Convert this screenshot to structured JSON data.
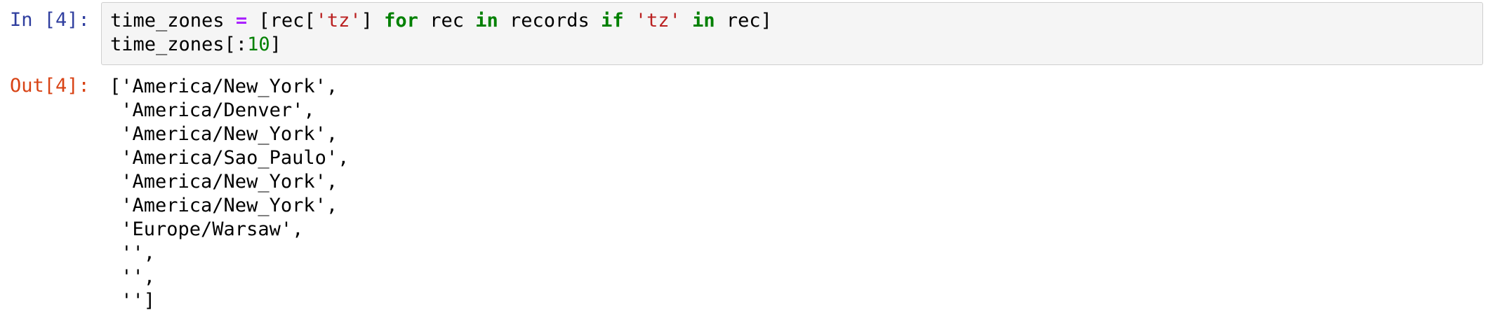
{
  "input_cell": {
    "prompt": "In [4]:",
    "code": {
      "line1": {
        "t1": "time_zones ",
        "op": "=",
        "t2": " [rec[",
        "s1": "'tz'",
        "t3": "] ",
        "k1": "for",
        "t4": " rec ",
        "k2": "in",
        "t5": " records ",
        "k3": "if",
        "t6": " ",
        "s2": "'tz'",
        "t7": " ",
        "k4": "in",
        "t8": " rec]"
      },
      "line2": {
        "t1": "time_zones[:",
        "num": "10",
        "t2": "]"
      }
    }
  },
  "output_cell": {
    "prompt": "Out[4]:",
    "lines": [
      "['America/New_York',",
      " 'America/Denver',",
      " 'America/New_York',",
      " 'America/Sao_Paulo',",
      " 'America/New_York',",
      " 'America/New_York',",
      " 'Europe/Warsaw',",
      " '',",
      " '',",
      " '']"
    ]
  }
}
